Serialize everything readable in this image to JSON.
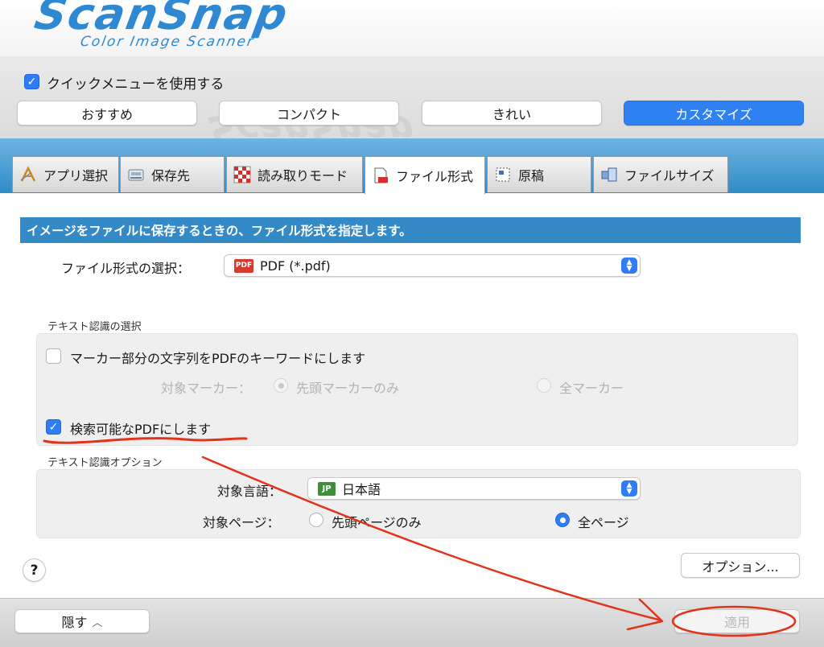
{
  "logo": {
    "brand": "ScanSnap",
    "tagline": "Color Image Scanner"
  },
  "quick_menu": {
    "checked": true,
    "label": "クイックメニューを使用する"
  },
  "presets": [
    {
      "label": "おすすめ",
      "selected": false
    },
    {
      "label": "コンパクト",
      "selected": false
    },
    {
      "label": "きれい",
      "selected": false
    },
    {
      "label": "カスタマイズ",
      "selected": true
    }
  ],
  "tabs": [
    {
      "label": "アプリ選択",
      "icon": "app-select-icon",
      "active": false
    },
    {
      "label": "保存先",
      "icon": "save-destination-icon",
      "active": false
    },
    {
      "label": "読み取りモード",
      "icon": "scan-mode-icon",
      "active": false
    },
    {
      "label": "ファイル形式",
      "icon": "file-format-icon",
      "active": true
    },
    {
      "label": "原稿",
      "icon": "document-icon",
      "active": false
    },
    {
      "label": "ファイルサイズ",
      "icon": "file-size-icon",
      "active": false
    }
  ],
  "info_text": "イメージをファイルに保存するときの、ファイル形式を指定します。",
  "file_format": {
    "label": "ファイル形式の選択：",
    "value": "PDF (*.pdf)",
    "icon_text": "PDF"
  },
  "text_recognition": {
    "section_label": "テキスト認識の選択",
    "marker_checkbox": {
      "label": "マーカー部分の文字列をPDFのキーワードにします",
      "checked": false
    },
    "target_marker_label": "対象マーカー：",
    "marker_options": [
      {
        "label": "先頭マーカーのみ",
        "selected": true
      },
      {
        "label": "全マーカー",
        "selected": false
      }
    ],
    "searchable_checkbox": {
      "label": "検索可能なPDFにします",
      "checked": true
    }
  },
  "text_recognition_options": {
    "section_label": "テキスト認識オプション",
    "language_label": "対象言語：",
    "language_value": "日本語",
    "language_icon_text": "JP",
    "target_page_label": "対象ページ：",
    "page_options": [
      {
        "label": "先頭ページのみ",
        "selected": false
      },
      {
        "label": "全ページ",
        "selected": true
      }
    ]
  },
  "buttons": {
    "help": "?",
    "options": "オプション...",
    "hide": "隠す",
    "apply": "適用"
  },
  "colors": {
    "accent": "#2e7cf6",
    "band": "#3489c7",
    "annotation": "#e2341d"
  }
}
